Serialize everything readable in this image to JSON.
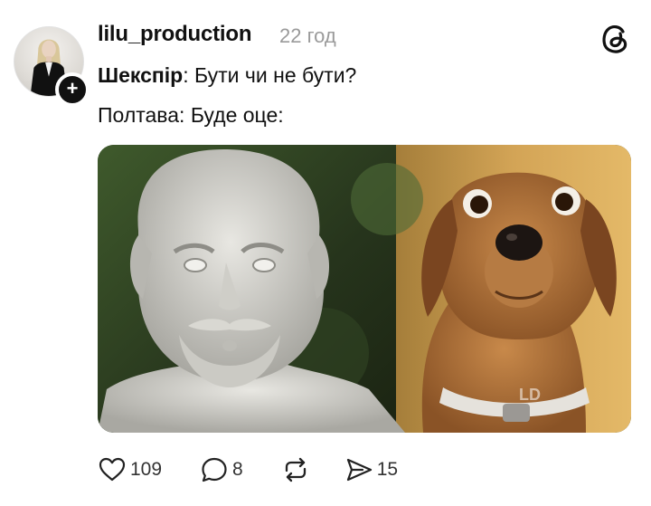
{
  "post": {
    "username": "lilu_production",
    "timestamp": "22 год",
    "follow_symbol": "+",
    "text_line1_bold": "Шекспір",
    "text_line1_rest": ": Бути чи не бути?",
    "text_line2": "Полтава: Буде оце:",
    "image_watermark": "LD"
  },
  "actions": {
    "likes": "109",
    "replies": "8",
    "reposts": "",
    "shares": "15"
  },
  "icons": {
    "logo": "threads-logo-icon",
    "like": "heart-icon",
    "reply": "comment-bubble-icon",
    "repost": "repost-icon",
    "share": "send-icon"
  },
  "colors": {
    "text": "#111111",
    "muted": "#9a9a9a",
    "badge": "#111111"
  }
}
